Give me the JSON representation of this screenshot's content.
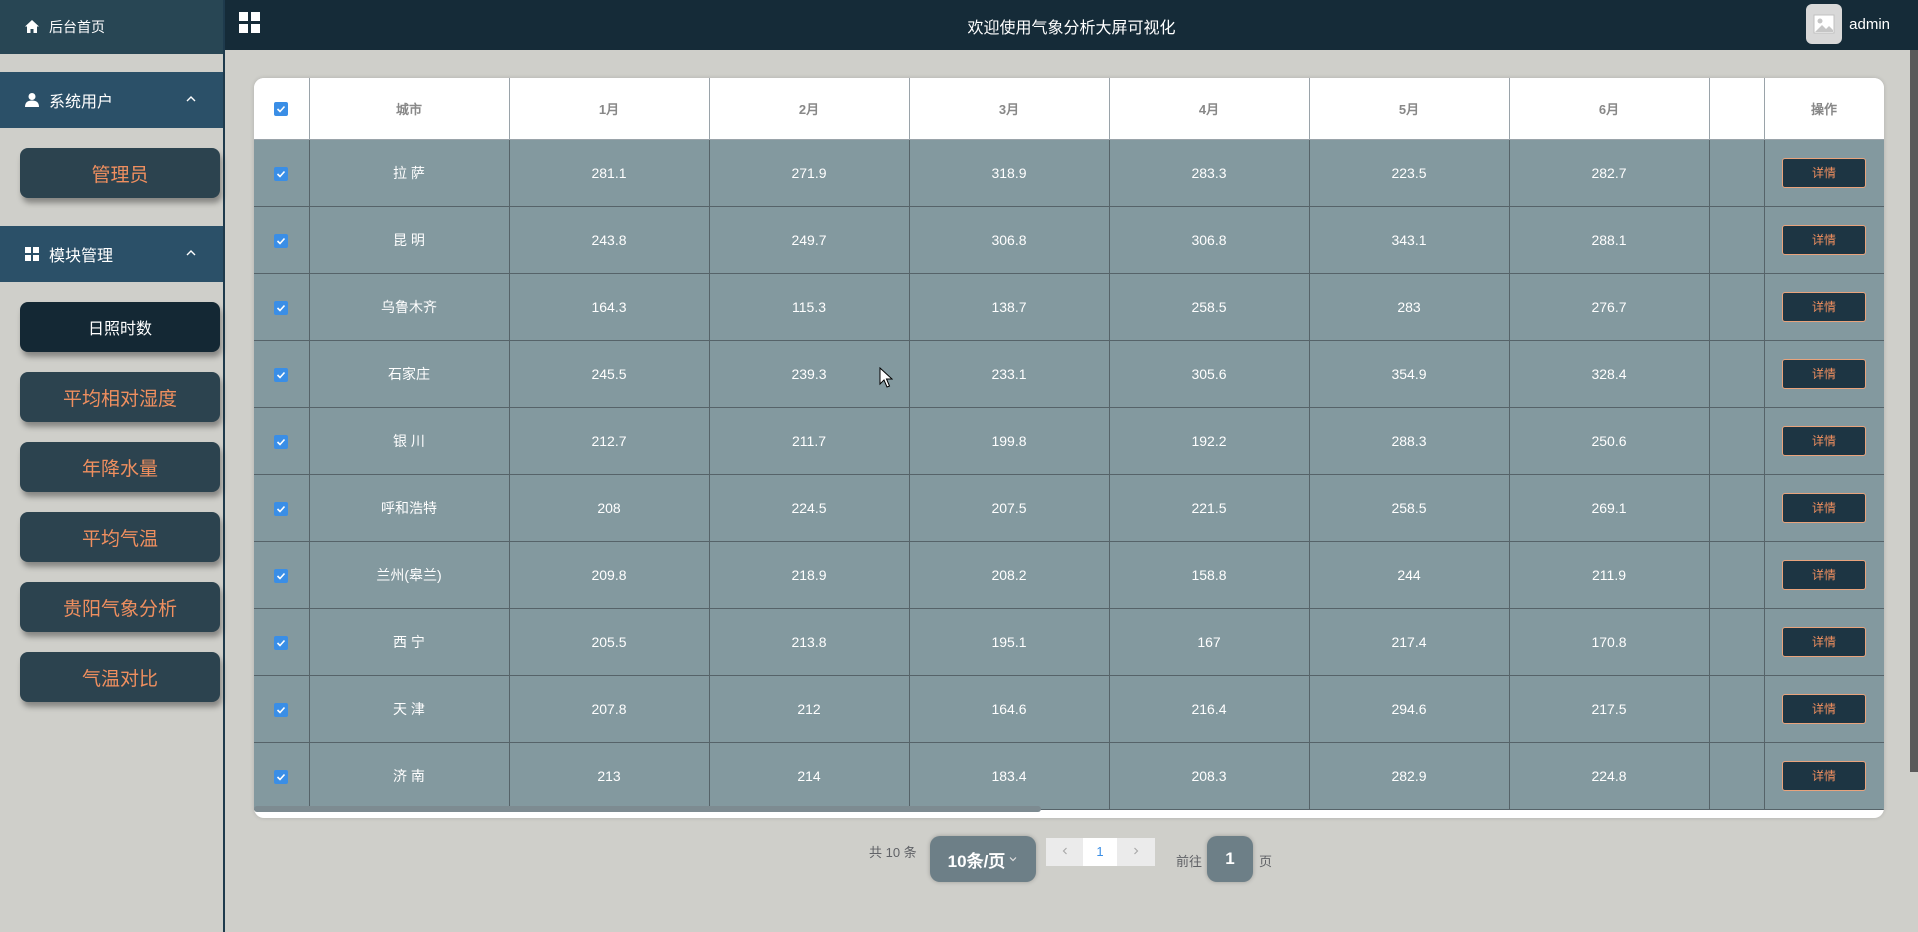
{
  "sidebar": {
    "home_label": "后台首页",
    "groups": [
      {
        "title": "系统用户",
        "items": [
          "管理员"
        ]
      },
      {
        "title": "模块管理",
        "items": [
          "日照时数",
          "平均相对湿度",
          "年降水量",
          "平均气温",
          "贵阳气象分析",
          "气温对比"
        ]
      }
    ],
    "active_item": "日照时数"
  },
  "header": {
    "title": "欢迎使用气象分析大屏可视化",
    "user": "admin"
  },
  "table": {
    "columns": [
      "城市",
      "1月",
      "2月",
      "3月",
      "4月",
      "5月",
      "6月",
      "",
      "操作"
    ],
    "action_label": "详情",
    "rows": [
      [
        "拉 萨",
        "281.1",
        "271.9",
        "318.9",
        "283.3",
        "223.5",
        "282.7"
      ],
      [
        "昆 明",
        "243.8",
        "249.7",
        "306.8",
        "306.8",
        "343.1",
        "288.1"
      ],
      [
        "乌鲁木齐",
        "164.3",
        "115.3",
        "138.7",
        "258.5",
        "283",
        "276.7"
      ],
      [
        "石家庄",
        "245.5",
        "239.3",
        "233.1",
        "305.6",
        "354.9",
        "328.4"
      ],
      [
        "银 川",
        "212.7",
        "211.7",
        "199.8",
        "192.2",
        "288.3",
        "250.6"
      ],
      [
        "呼和浩特",
        "208",
        "224.5",
        "207.5",
        "221.5",
        "258.5",
        "269.1"
      ],
      [
        "兰州(皋兰)",
        "209.8",
        "218.9",
        "208.2",
        "158.8",
        "244",
        "211.9"
      ],
      [
        "西 宁",
        "205.5",
        "213.8",
        "195.1",
        "167",
        "217.4",
        "170.8"
      ],
      [
        "天 津",
        "207.8",
        "212",
        "164.6",
        "216.4",
        "294.6",
        "217.5"
      ],
      [
        "济 南",
        "213",
        "214",
        "183.4",
        "208.3",
        "282.9",
        "224.8"
      ]
    ]
  },
  "pagination": {
    "total": "共 10 条",
    "page_size": "10条/页",
    "current_page": "1",
    "goto_label": "前往",
    "goto_value": "1",
    "goto_suffix": "页"
  },
  "colors": {
    "sidebar_button_bg": "#2c434f",
    "sidebar_button_text": "#f08f5f",
    "header_bg": "#152b38",
    "table_cell_bg": "#83999f",
    "checkbox_blue": "#3a8ee6"
  }
}
